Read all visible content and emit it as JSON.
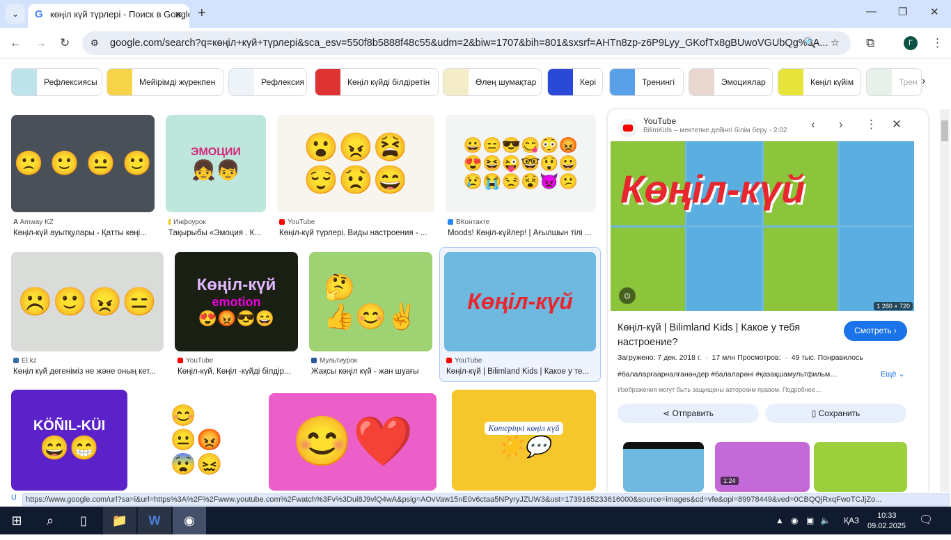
{
  "browser": {
    "tab_title": "көңіл күй түрлері - Поиск в Google",
    "url": "google.com/search?q=көңіл+күй+түрлері&sca_esv=550f8b5888f48c55&udm=2&biw=1707&bih=801&sxsrf=AHTn8zp-z6P9Lyy_GKofTx8gBUwoVGUbQg%3A...",
    "avatar": "Г",
    "status_url": "https://www.google.com/url?sa=i&url=https%3A%2F%2Fwww.youtube.com%2Fwatch%3Fv%3Dui8J9vlQ4wA&psig=AOvVaw15nE0v6ctaa5NPyryJZUW3&ust=1739165233616000&source=images&cd=vfe&opi=89978449&ved=0CBQQjRxqFwoTCJjZo..."
  },
  "chips": [
    "Рефлексиясы",
    "Мейірімді жүрекпен",
    "Рефлексия",
    "Көңіл күйді білдіретін",
    "Өлең шумақтар",
    "Кері",
    "Тренингі",
    "Эмоциялар",
    "Көңіл күйім",
    "Трен"
  ],
  "results": [
    {
      "source": "Amway KZ",
      "title": "Көңіл-күй ауытқулары - Қатты көңі..."
    },
    {
      "source": "Инфоурок",
      "title": "Тақырыбы «Эмоция . К..."
    },
    {
      "source": "YouTube",
      "title": "Көңіл-күй түрлері. Виды настроения - ..."
    },
    {
      "source": "ВКонтакте",
      "title": "Moods! Көңіл-күйлер! | Ағылшын тілі ..."
    },
    {
      "source": "El.kz",
      "title": "Көңіл күй дегеніміз не және оның кет..."
    },
    {
      "source": "YouTube",
      "title": "Көңіл-күй. Көңіл -күйді білдір..."
    },
    {
      "source": "Мультиурок",
      "title": "Жақсы көңіл күй - жан шуағы"
    },
    {
      "source": "YouTube",
      "title": "Көңіл-күй | Bilimland Kids | Какое у те..."
    }
  ],
  "image_text": {
    "emotions": "ЭМОЦИИ",
    "konil": "Көңіл-күй",
    "emotion": "emotion",
    "alashuly": "KÖÑIL-KÜI",
    "kuletin": "Көтеріңкі көңіл күй"
  },
  "panel": {
    "source": "YouTube",
    "channel": "BilimKids – мектепке дейінгі білім беру · 2:02",
    "hero_text": "Көңіл-күй",
    "dims": "1 280 × 720",
    "title": "Көңіл-күй | Bilimland Kids | Какое у тебя настроение?",
    "watch": "Смотреть ›",
    "meta": "Загружено: 7 дек. 2018 г.  ·  17 млн Просмотров:  ·  49 тыс. Понравилось",
    "tags": "#балаларғаарналғанәндер #балаларәні #қазақшамультфильм…",
    "more": "Ещё ⌄",
    "copyright": "Изображения могут быть защищены авторским правом. Подробнее…",
    "share": "Отправить",
    "save": "Сохранить",
    "duration": "1:24"
  },
  "taskbar": {
    "lang": "ҚАЗ",
    "time": "10:33",
    "date": "09.02.2025"
  }
}
